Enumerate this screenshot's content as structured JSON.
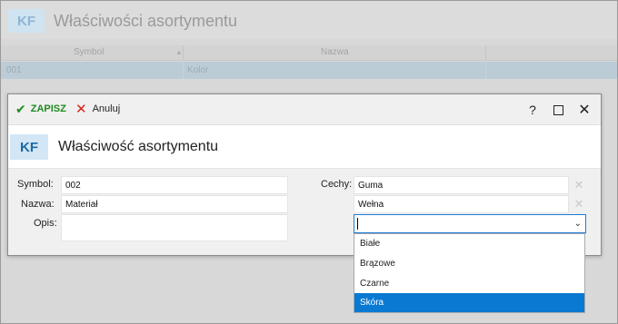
{
  "background": {
    "logo": "KF",
    "title": "Właściwości asortymentu",
    "columns": [
      "Symbol",
      "Nazwa"
    ],
    "sort_icon": "sort-up-icon",
    "row": {
      "symbol": "001",
      "nazwa": "Kolor"
    }
  },
  "dialog": {
    "toolbar": {
      "save_label": "ZAPISZ",
      "cancel_label": "Anuluj",
      "help_label": "?"
    },
    "logo": "KF",
    "title": "Właściwość asortymentu",
    "form": {
      "symbol_label": "Symbol:",
      "symbol_value": "002",
      "nazwa_label": "Nazwa:",
      "nazwa_value": "Materiał",
      "opis_label": "Opis:",
      "opis_value": "",
      "cechy_label": "Cechy:",
      "cechy": [
        "Guma",
        "Wełna"
      ],
      "new_cecha_value": ""
    },
    "dropdown": {
      "options": [
        "Białe",
        "Brązowe",
        "Czarne",
        "Skóra"
      ],
      "highlighted": "Skóra"
    }
  },
  "colors": {
    "accent": "#0a79d2",
    "save_green": "#1f8a1f",
    "cancel_red": "#d9261c",
    "logo_blue": "#1c6aa6"
  }
}
